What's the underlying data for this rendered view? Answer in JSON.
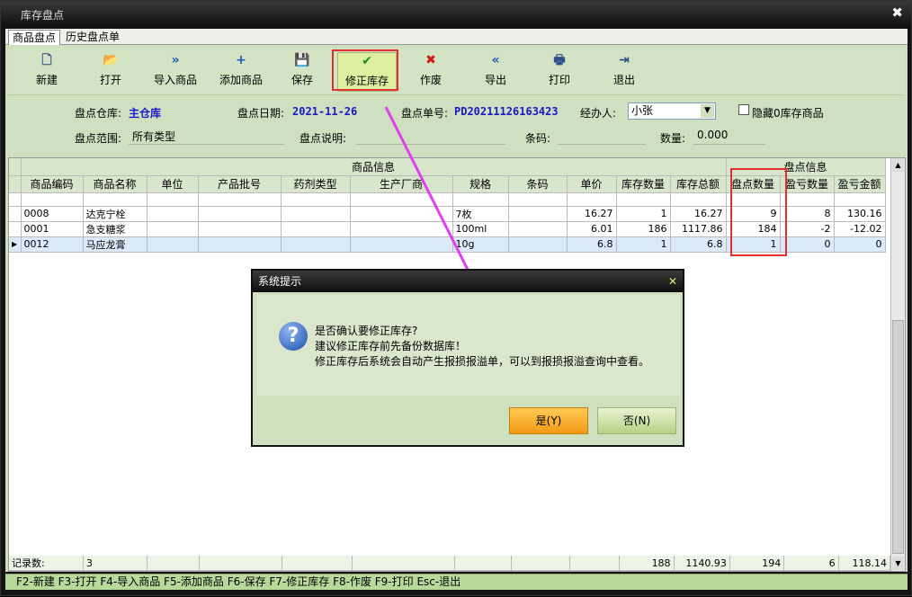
{
  "window": {
    "title": "库存盘点",
    "close": "✖"
  },
  "tabs": [
    {
      "label": "商品盘点"
    },
    {
      "label": "历史盘点单"
    }
  ],
  "toolbar": [
    {
      "label": "新建",
      "icon": "new-doc-icon",
      "glyph": "🗋",
      "color": "#2a4e8a"
    },
    {
      "label": "打开",
      "icon": "open-folder-icon",
      "glyph": "📂",
      "color": "#d39b24"
    },
    {
      "label": "导入商品",
      "icon": "import-icon",
      "glyph": "»",
      "color": "#1e58b8"
    },
    {
      "label": "添加商品",
      "icon": "add-icon",
      "glyph": "+",
      "color": "#1e58b8"
    },
    {
      "label": "保存",
      "icon": "save-icon",
      "glyph": "💾",
      "color": "#2a4e8a"
    },
    {
      "label": "修正库存",
      "icon": "check-icon",
      "glyph": "✔",
      "color": "#1d8a1d"
    },
    {
      "label": "作废",
      "icon": "cross-icon",
      "glyph": "✖",
      "color": "#d01818"
    },
    {
      "label": "导出",
      "icon": "export-icon",
      "glyph": "«",
      "color": "#1e58b8"
    },
    {
      "label": "打印",
      "icon": "print-icon",
      "glyph": "🖶",
      "color": "#2a4e8a"
    },
    {
      "label": "退出",
      "icon": "exit-icon",
      "glyph": "⇥",
      "color": "#2a4e8a"
    }
  ],
  "form": {
    "warehouse_label": "盘点仓库:",
    "warehouse": "主仓库",
    "date_label": "盘点日期:",
    "date": "2021-11-26",
    "order_label": "盘点单号:",
    "order": "PD20211126163423",
    "handler_label": "经办人:",
    "handler": "小张",
    "hide_zero_label": "隐藏0库存商品",
    "scope_label": "盘点范围:",
    "scope": "所有类型",
    "desc_label": "盘点说明:",
    "desc": "",
    "barcode_label": "条码:",
    "barcode": "",
    "qty_label": "数量:",
    "qty": "0.000"
  },
  "grid": {
    "group_product": "商品信息",
    "group_stock": "盘点信息",
    "columns": [
      "商品编码",
      "商品名称",
      "单位",
      "产品批号",
      "药剂类型",
      "生产厂商",
      "规格",
      "条码",
      "单价",
      "库存数量",
      "库存总额",
      "盘点数量",
      "盈亏数量",
      "盈亏金额"
    ],
    "rows": [
      [
        "0008",
        "达克宁栓",
        "",
        "",
        "",
        "",
        "7枚",
        "",
        "16.27",
        "1",
        "16.27",
        "9",
        "8",
        "130.16"
      ],
      [
        "0001",
        "急支糖浆",
        "",
        "",
        "",
        "",
        "100ml",
        "",
        "6.01",
        "186",
        "1117.86",
        "184",
        "-2",
        "-12.02"
      ],
      [
        "0012",
        "马应龙膏",
        "",
        "",
        "",
        "",
        "10g",
        "",
        "6.8",
        "1",
        "6.8",
        "1",
        "0",
        "0"
      ]
    ],
    "footer_label": "记录数:",
    "footer_count": "3",
    "footer_totals": {
      "stock_qty": "188",
      "stock_amount": "1140.93",
      "count_qty": "194",
      "diff_qty": "6",
      "diff_amount": "118.14"
    }
  },
  "statusbar": "F2-新建 F3-打开 F4-导入商品 F5-添加商品 F6-保存 F7-修正库存 F8-作废 F9-打印 Esc-退出",
  "dialog": {
    "title": "系统提示",
    "close": "✕",
    "icon": "question-icon",
    "line1": "是否确认要修正库存?",
    "line2": "建议修正库存前先备份数据库！",
    "line3": "修正库存后系统会自动产生报损报溢单，可以到报损报溢查询中查看。",
    "yes": "是(Y)",
    "no": "否(N)"
  }
}
